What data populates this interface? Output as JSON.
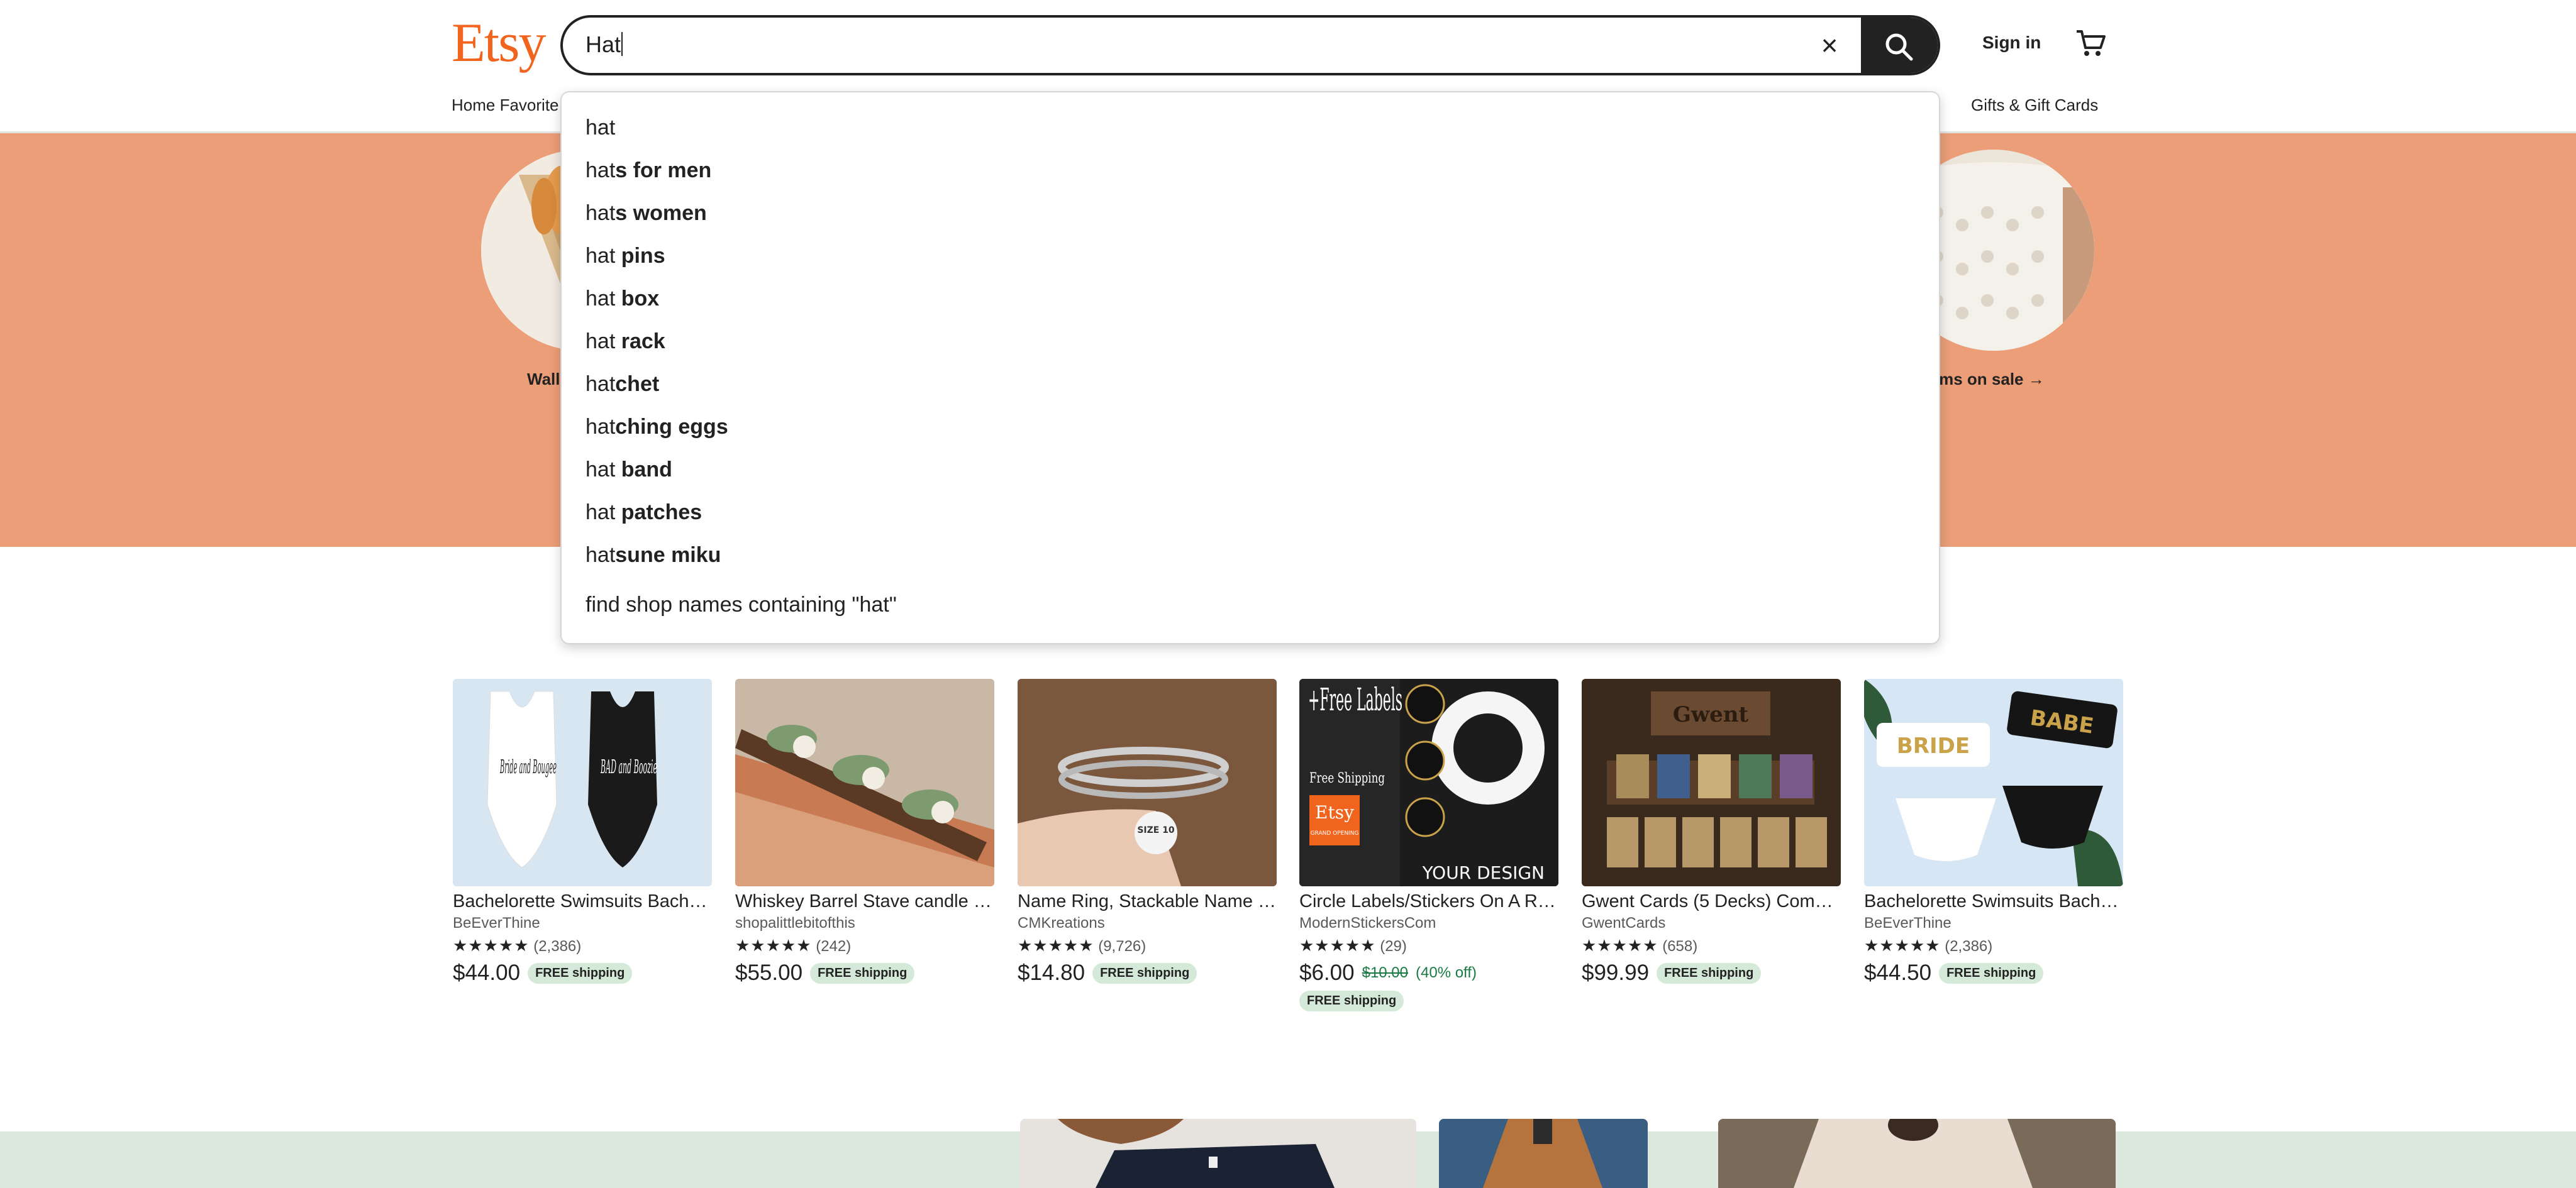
{
  "header": {
    "logo": "Etsy",
    "search_value": "Hat",
    "signin_label": "Sign in",
    "nav_left": "Home Favorite",
    "nav_right": "Gifts & Gift Cards"
  },
  "hero": {
    "label_left": "Wall",
    "label_right": "tems on sale"
  },
  "suggestions": [
    {
      "prefix": "hat",
      "rest": ""
    },
    {
      "prefix": "hat",
      "rest": "s for men"
    },
    {
      "prefix": "hat",
      "rest": "s women"
    },
    {
      "prefix": "hat ",
      "rest": "pins"
    },
    {
      "prefix": "hat ",
      "rest": "box"
    },
    {
      "prefix": "hat ",
      "rest": "rack"
    },
    {
      "prefix": "hat",
      "rest": "chet"
    },
    {
      "prefix": "hat",
      "rest": "ching eggs"
    },
    {
      "prefix": "hat ",
      "rest": "band"
    },
    {
      "prefix": "hat ",
      "rest": "patches"
    },
    {
      "prefix": "hat",
      "rest": "sune miku"
    }
  ],
  "shop_names_label": "find shop names containing \"hat\"",
  "products": [
    {
      "title": "Bachelorette Swimsuits Bach…",
      "shop": "BeEverThine",
      "stars": "★★★★★",
      "count": "(2,386)",
      "price": "$44.00",
      "orig": "",
      "discount": "",
      "shipping": "FREE shipping"
    },
    {
      "title": "Whiskey Barrel Stave candle …",
      "shop": "shopalittlebitofthis",
      "stars": "★★★★★",
      "count": "(242)",
      "price": "$55.00",
      "orig": "",
      "discount": "",
      "shipping": "FREE shipping"
    },
    {
      "title": "Name Ring, Stackable Name …",
      "shop": "CMKreations",
      "stars": "★★★★★",
      "count": "(9,726)",
      "price": "$14.80",
      "orig": "",
      "discount": "",
      "shipping": "FREE shipping"
    },
    {
      "title": "Circle Labels/Stickers On A R…",
      "shop": "ModernStickersCom",
      "stars": "★★★★★",
      "count": "(29)",
      "price": "$6.00",
      "orig": "$10.00",
      "discount": "(40% off)",
      "shipping": "FREE shipping"
    },
    {
      "title": "Gwent Cards (5 Decks) Com…",
      "shop": "GwentCards",
      "stars": "★★★★★",
      "count": "(658)",
      "price": "$99.99",
      "orig": "",
      "discount": "",
      "shipping": "FREE shipping"
    },
    {
      "title": "Bachelorette Swimsuits Bach…",
      "shop": "BeEverThine",
      "stars": "★★★★★",
      "count": "(2,386)",
      "price": "$44.50",
      "orig": "",
      "discount": "",
      "shipping": "FREE shipping"
    }
  ],
  "image_text": {
    "bride_left": "Bride and Bougee",
    "bad_right": "BAD and Boozie",
    "labels_free": "+Free Labels",
    "free_shipping": "Free Shipping",
    "etsy_badge": "Etsy",
    "grand_opening": "GRAND OPENING",
    "your_design": "YOUR DESIGN",
    "gwent": "Gwent",
    "size": "SIZE 10",
    "bride": "BRIDE",
    "babe": "BABE"
  },
  "colors": {
    "brand": "#f1641e",
    "hero_bg": "#eb9e78",
    "badge_bg": "#d4e9d7",
    "sale_green": "#1b7a43"
  }
}
